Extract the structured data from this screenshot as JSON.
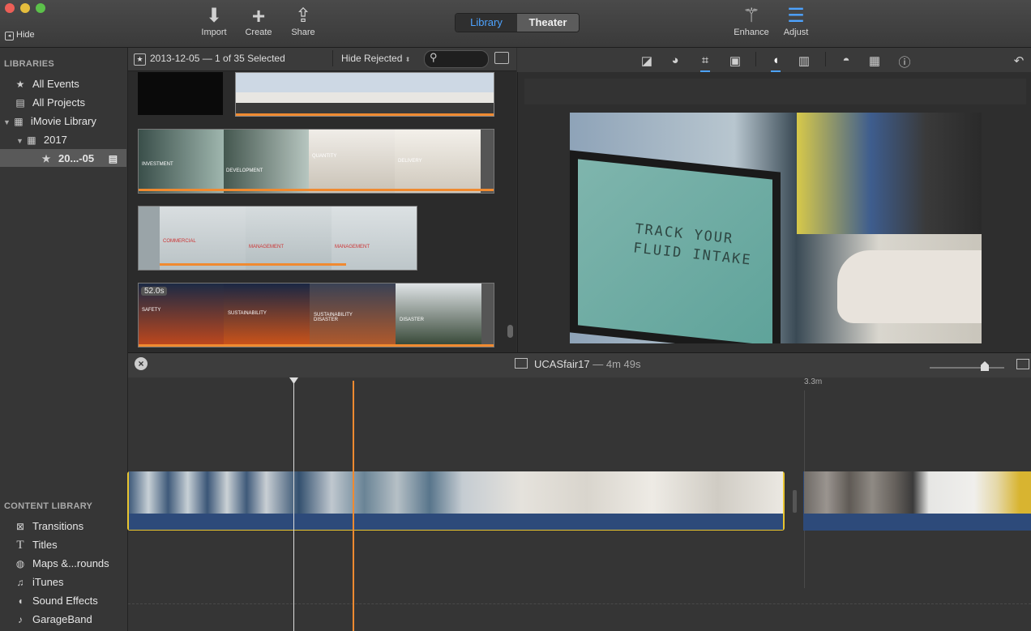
{
  "window": {
    "hide_label": "Hide"
  },
  "toolbar": {
    "import_label": "Import",
    "create_label": "Create",
    "share_label": "Share",
    "library_tab": "Library",
    "theater_tab": "Theater",
    "enhance_label": "Enhance",
    "adjust_label": "Adjust",
    "accent": "#4da3ff"
  },
  "sidebar": {
    "libraries_heading": "LIBRARIES",
    "items": [
      {
        "label": "All Events",
        "icon": "star-icon"
      },
      {
        "label": "All Projects",
        "icon": "clapper-icon"
      },
      {
        "label": "iMovie Library",
        "icon": "grid-icon"
      },
      {
        "label": "2017",
        "icon": "calendar-icon"
      },
      {
        "label": "20...-05",
        "icon": "star-icon"
      }
    ],
    "content_heading": "CONTENT LIBRARY",
    "content_items": [
      {
        "label": "Transitions",
        "icon": "transitions-icon"
      },
      {
        "label": "Titles",
        "icon": "titles-icon"
      },
      {
        "label": "Maps &...rounds",
        "icon": "globe-icon"
      },
      {
        "label": "iTunes",
        "icon": "music-note-icon"
      },
      {
        "label": "Sound Effects",
        "icon": "speaker-icon"
      },
      {
        "label": "GarageBand",
        "icon": "guitar-icon"
      }
    ]
  },
  "browser": {
    "event_title": "2013-12-05 — 1 of 35 Selected",
    "filter": "Hide Rejected",
    "duration_badge": "52.0s",
    "clip_labels": [
      "INVESTMENT",
      "DEVELOPMENT",
      "QUANTITY",
      "DELIVERY",
      "COMMERCIAL",
      "MANAGEMENT",
      "MANAGEMENT",
      "SAFETY",
      "SUSTAINABILITY",
      "SUSTAINABILITY DISASTER",
      "DISASTER"
    ]
  },
  "viewer": {
    "video_text_line1": "TRACK YOUR",
    "video_text_line2": "FLUID INTAKE"
  },
  "timeline": {
    "project_name": "UCASfair17",
    "project_duration": "— 4m 49s",
    "time_marker": "3.3m",
    "playhead_color": "#f08a30"
  }
}
